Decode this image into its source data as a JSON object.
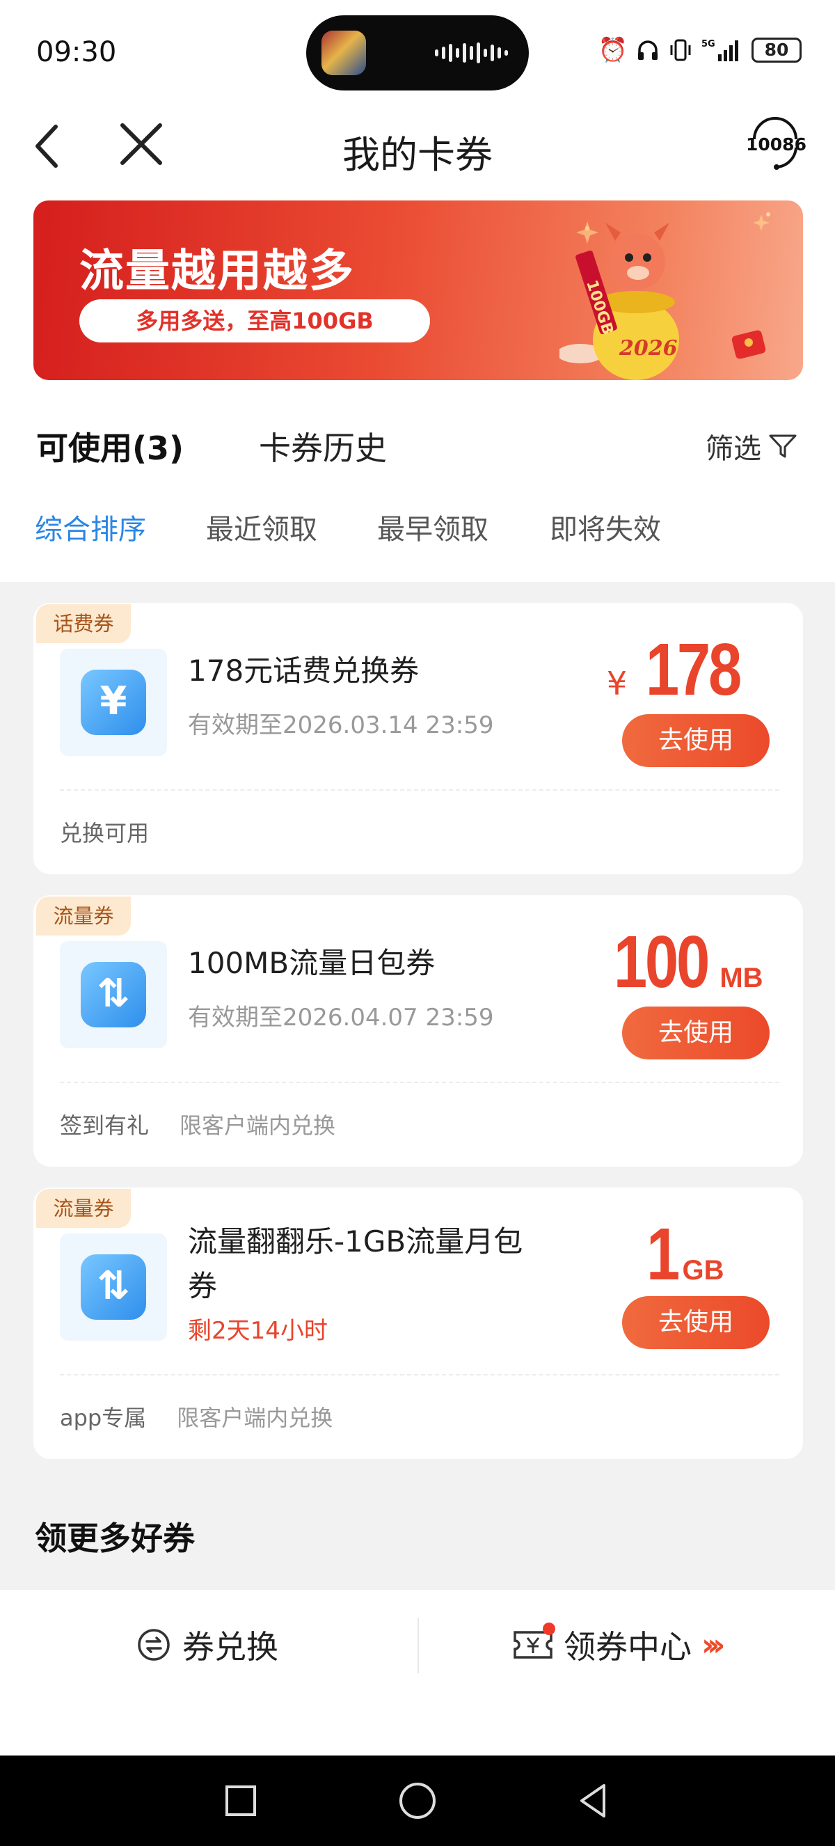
{
  "status_bar": {
    "time": "09:30",
    "battery": "80"
  },
  "nav": {
    "title": "我的卡券",
    "service_label": "10086"
  },
  "banner": {
    "title": "流量越用越多",
    "subtitle": "多用多送，至高100GB",
    "scroll_text": "100GB",
    "year_text": "2026"
  },
  "tabs": {
    "available": "可使用(3)",
    "history": "卡券历史",
    "filter": "筛选"
  },
  "sort_options": [
    "综合排序",
    "最近领取",
    "最早领取",
    "即将失效"
  ],
  "coupons": [
    {
      "tag": "话费券",
      "icon": "yuan",
      "icon_glyph": "¥",
      "title": "178元话费兑换券",
      "sub": "有效期至2026.03.14 23:59",
      "value_prefix": "¥",
      "value": "178",
      "unit": "",
      "button": "去使用",
      "footer": [
        "兑换可用"
      ]
    },
    {
      "tag": "流量券",
      "icon": "data-arrows",
      "icon_glyph": "⇅",
      "title": "100MB流量日包券",
      "sub": "有效期至2026.04.07 23:59",
      "value_prefix": "",
      "value": "100",
      "unit": "MB",
      "button": "去使用",
      "footer": [
        "签到有礼",
        "限客户端内兑换"
      ]
    },
    {
      "tag": "流量券",
      "icon": "data-arrows",
      "icon_glyph": "⇅",
      "title": "流量翻翻乐-1GB流量月包券",
      "sub": "剩2天14小时",
      "value_prefix": "",
      "value": "1",
      "unit": "GB",
      "button": "去使用",
      "footer": [
        "app专属",
        "限客户端内兑换"
      ]
    }
  ],
  "more_section": {
    "title": "领更多好券"
  },
  "bottom_bar": {
    "exchange": "券兑换",
    "center": "领券中心"
  },
  "colors": {
    "accent_red": "#e8452c",
    "accent_blue": "#2a86e5",
    "tag_bg": "#fde9cf"
  }
}
